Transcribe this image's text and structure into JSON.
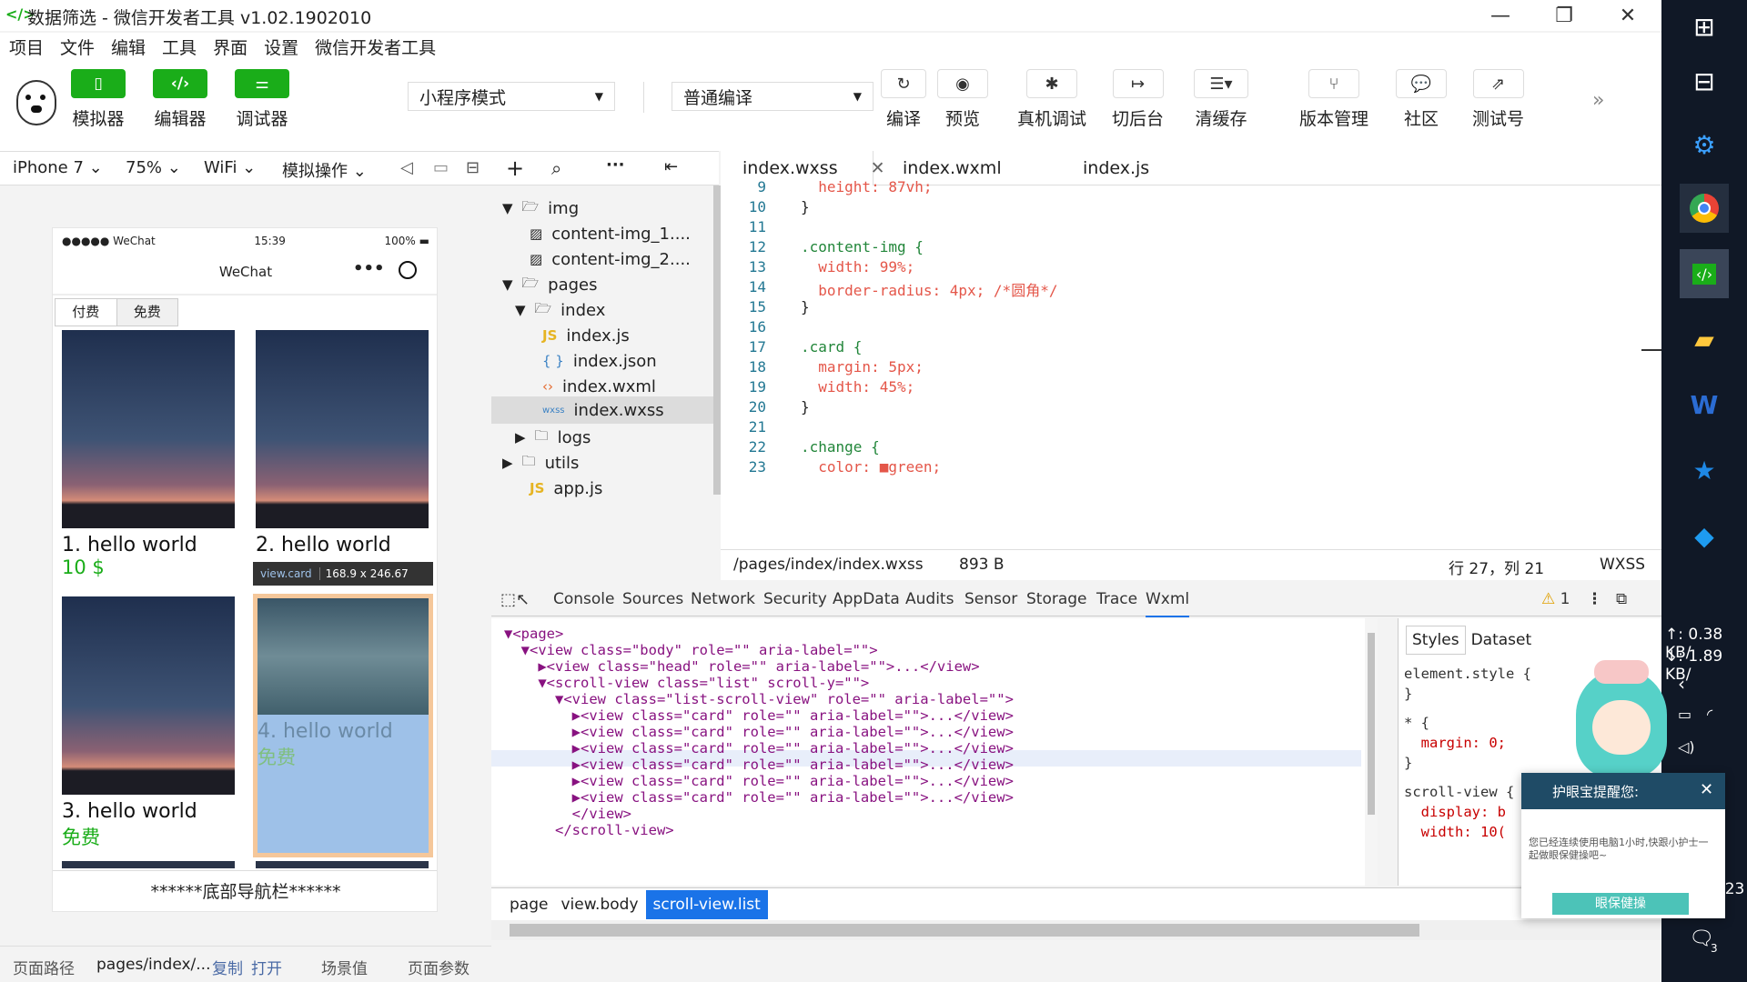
{
  "window": {
    "title": "数据筛选 - 微信开发者工具 v1.02.1902010",
    "icon": "</>"
  },
  "menu": [
    "项目",
    "文件",
    "编辑",
    "工具",
    "界面",
    "设置",
    "微信开发者工具"
  ],
  "toolbar": {
    "simulator": "模拟器",
    "editor": "编辑器",
    "debugger": "调试器",
    "mode_select": "小程序模式",
    "compile_select": "普通编译",
    "compile": "编译",
    "preview": "预览",
    "remote_debug": "真机调试",
    "background": "切后台",
    "clear_cache": "清缓存",
    "version": "版本管理",
    "community": "社区",
    "test_account": "测试号"
  },
  "device_bar": {
    "device": "iPhone 7",
    "zoom": "75%",
    "network": "WiFi",
    "sim_ops": "模拟操作"
  },
  "phone": {
    "carrier": "●●●●● WeChat",
    "time": "15:39",
    "battery": "100%",
    "nav_title": "WeChat",
    "filter_tabs": [
      "付费",
      "免费"
    ],
    "cards": [
      {
        "title": "1. hello world",
        "price": "10 $"
      },
      {
        "title": "2. hello world",
        "price": ""
      },
      {
        "title": "3. hello world",
        "price": "免费"
      },
      {
        "title": "4. hello world",
        "price": "免费"
      }
    ],
    "tooltip_selector": "view.card",
    "tooltip_size": "168.9 x 246.67",
    "bottom_nav": "******底部导航栏******"
  },
  "explorer": {
    "items": [
      {
        "name": "img",
        "type": "folder-open"
      },
      {
        "name": "content-img_1....",
        "type": "image"
      },
      {
        "name": "content-img_2....",
        "type": "image"
      },
      {
        "name": "pages",
        "type": "folder-open"
      },
      {
        "name": "index",
        "type": "folder-open"
      },
      {
        "name": "index.js",
        "type": "js"
      },
      {
        "name": "index.json",
        "type": "json"
      },
      {
        "name": "index.wxml",
        "type": "wxml"
      },
      {
        "name": "index.wxss",
        "type": "wxss"
      },
      {
        "name": "logs",
        "type": "folder"
      },
      {
        "name": "utils",
        "type": "folder"
      },
      {
        "name": "app.js",
        "type": "js"
      }
    ]
  },
  "editor_tabs": [
    "index.wxss",
    "index.wxml",
    "index.js"
  ],
  "code_lines": [
    {
      "n": "9",
      "text": "  height: 87vh;"
    },
    {
      "n": "10",
      "text": "}"
    },
    {
      "n": "11",
      "text": ""
    },
    {
      "n": "12",
      "text": ".content-img {"
    },
    {
      "n": "13",
      "text": "  width: 99%;"
    },
    {
      "n": "14",
      "text": "  border-radius: 4px; /*圆角*/"
    },
    {
      "n": "15",
      "text": "}"
    },
    {
      "n": "16",
      "text": ""
    },
    {
      "n": "17",
      "text": ".card {"
    },
    {
      "n": "18",
      "text": "  margin: 5px;"
    },
    {
      "n": "19",
      "text": "  width: 45%;"
    },
    {
      "n": "20",
      "text": "}"
    },
    {
      "n": "21",
      "text": ""
    },
    {
      "n": "22",
      "text": ".change {"
    },
    {
      "n": "23",
      "text": "  color: ■green;"
    }
  ],
  "status": {
    "path": "/pages/index/index.wxss",
    "size": "893 B",
    "position": "行 27，列 21",
    "lang": "WXSS"
  },
  "devtools_tabs": [
    "Console",
    "Sources",
    "Network",
    "Security",
    "AppData",
    "Audits",
    "Sensor",
    "Storage",
    "Trace",
    "Wxml"
  ],
  "warnings": "1",
  "wxml_lines": [
    "▼<page>",
    "  ▼<view class=\"body\" role=\"\" aria-label=\"\">",
    "    ▶<view class=\"head\" role=\"\" aria-label=\"\">...</view>",
    "    ▼<scroll-view class=\"list\" scroll-y=\"\">",
    "      ▼<view class=\"list-scroll-view\" role=\"\" aria-label=\"\">",
    "        ▶<view class=\"card\" role=\"\" aria-label=\"\">...</view>",
    "        ▶<view class=\"card\" role=\"\" aria-label=\"\">...</view>",
    "        ▶<view class=\"card\" role=\"\" aria-label=\"\">...</view>",
    "        ▶<view class=\"card\" role=\"\" aria-label=\"\">...</view>",
    "        ▶<view class=\"card\" role=\"\" aria-label=\"\">...</view>",
    "        ▶<view class=\"card\" role=\"\" aria-label=\"\">...</view>",
    "        </view>",
    "      </scroll-view>"
  ],
  "styles_panel": {
    "tabs": [
      "Styles",
      "Dataset"
    ],
    "lines": [
      "element.style {",
      "}",
      "* {",
      "  margin: 0;",
      "}",
      "scroll-view {",
      "  display: b",
      "  width: 10("
    ]
  },
  "crumbs": [
    "page",
    "view.body",
    "scroll-view.list"
  ],
  "bottom": {
    "path_label": "页面路径",
    "path": "pages/index/...",
    "copy": "复制",
    "open": "打开",
    "scene": "场景值",
    "params": "页面参数"
  },
  "taskbar": {
    "net_up": "↑: 0.38 KB/",
    "net_down": "↓: 1.89 KB/",
    "date_fragment": "/23",
    "notif_count": "3"
  },
  "popup": {
    "title": "护眼宝提醒您:",
    "body": "您已经连续使用电脑1小时,快跟小护士一起做眼保健操吧~",
    "button": "眼保健操"
  },
  "colors": {
    "green": "#1aad19",
    "taskbar": "#101826",
    "highlight": "#9ec1e8",
    "selected_crumb": "#1a73e8"
  }
}
